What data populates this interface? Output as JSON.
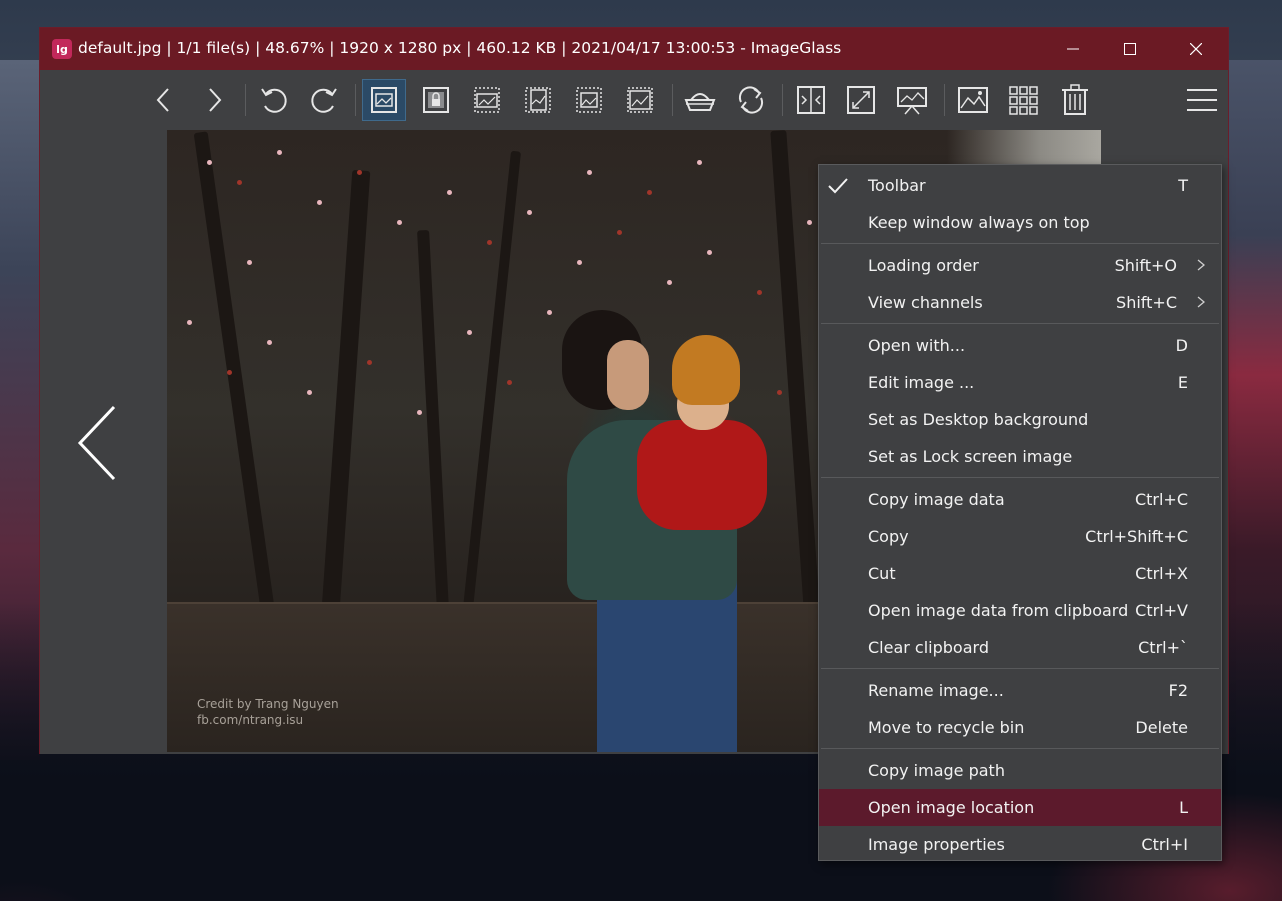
{
  "window": {
    "title": "default.jpg  |  1/1 file(s)  |  48.67%  |  1920 x 1280 px  |  460.12 KB  |  2021/04/17 13:00:53  - ImageGlass",
    "logo_text": "lg"
  },
  "toolbar": {
    "buttons": [
      {
        "name": "view-previous",
        "icon": "chevron-left"
      },
      {
        "name": "view-next",
        "icon": "chevron-right"
      },
      {
        "name": "rotate-left",
        "icon": "rotate-ccw"
      },
      {
        "name": "rotate-right",
        "icon": "rotate-cw"
      },
      {
        "name": "auto-zoom",
        "icon": "image-fit",
        "active": true
      },
      {
        "name": "lock-zoom",
        "icon": "image-lock"
      },
      {
        "name": "scale-to-width",
        "icon": "image-width"
      },
      {
        "name": "scale-to-height",
        "icon": "image-height"
      },
      {
        "name": "scale-to-fit",
        "icon": "image-fit-dashed"
      },
      {
        "name": "scale-to-fill",
        "icon": "image-fill"
      },
      {
        "name": "checkerboard",
        "icon": "basket"
      },
      {
        "name": "refresh",
        "icon": "refresh"
      },
      {
        "name": "go-to-image",
        "icon": "goto"
      },
      {
        "name": "full-screen",
        "icon": "fullscreen"
      },
      {
        "name": "slideshow",
        "icon": "presentation"
      },
      {
        "name": "set-wallpaper",
        "icon": "landscape"
      },
      {
        "name": "thumbnail-bar",
        "icon": "grid"
      },
      {
        "name": "delete",
        "icon": "trash"
      },
      {
        "name": "main-menu",
        "icon": "hamburger"
      }
    ]
  },
  "viewer": {
    "credit_line1": "Credit by Trang Nguyen",
    "credit_line2": "fb.com/ntrang.isu"
  },
  "menu": {
    "groups": [
      [
        {
          "label": "Toolbar",
          "shortcut": "T",
          "checked": true
        },
        {
          "label": "Keep window always on top",
          "shortcut": ""
        }
      ],
      [
        {
          "label": "Loading order",
          "shortcut": "Shift+O",
          "submenu": true
        },
        {
          "label": "View channels",
          "shortcut": "Shift+C",
          "submenu": true
        }
      ],
      [
        {
          "label": "Open with...",
          "shortcut": "D"
        },
        {
          "label": "Edit image ...",
          "shortcut": "E"
        },
        {
          "label": "Set as Desktop background",
          "shortcut": ""
        },
        {
          "label": "Set as Lock screen image",
          "shortcut": ""
        }
      ],
      [
        {
          "label": "Copy image data",
          "shortcut": "Ctrl+C"
        },
        {
          "label": "Copy",
          "shortcut": "Ctrl+Shift+C"
        },
        {
          "label": "Cut",
          "shortcut": "Ctrl+X"
        },
        {
          "label": "Open image data from clipboard",
          "shortcut": "Ctrl+V"
        },
        {
          "label": "Clear clipboard",
          "shortcut": "Ctrl+`"
        }
      ],
      [
        {
          "label": "Rename image...",
          "shortcut": "F2"
        },
        {
          "label": "Move to recycle bin",
          "shortcut": "Delete"
        }
      ],
      [
        {
          "label": "Copy image path",
          "shortcut": ""
        },
        {
          "label": "Open image location",
          "shortcut": "L",
          "active": true
        },
        {
          "label": "Image properties",
          "shortcut": "Ctrl+I"
        }
      ]
    ]
  },
  "colors": {
    "titlebar": "#6b1a24",
    "window_bg": "#3f4042",
    "menu_highlight": "#5c1a2c",
    "toolbar_active": "#2b4a66"
  }
}
